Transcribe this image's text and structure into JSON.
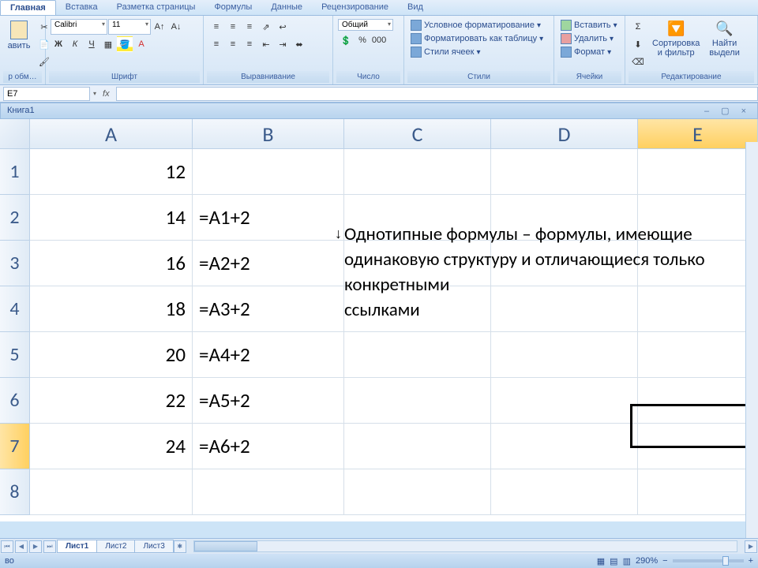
{
  "tabs": [
    "Главная",
    "Вставка",
    "Разметка страницы",
    "Формулы",
    "Данные",
    "Рецензирование",
    "Вид"
  ],
  "active_tab": 0,
  "ribbon": {
    "clipboard": {
      "paste": "авить",
      "label": "р обм…"
    },
    "font": {
      "name": "Calibri",
      "size": "11",
      "bold": "Ж",
      "italic": "К",
      "underline": "Ч",
      "label": "Шрифт"
    },
    "align": {
      "label": "Выравнивание"
    },
    "number": {
      "format": "Общий",
      "label": "Число"
    },
    "styles": {
      "cond": "Условное форматирование",
      "table": "Форматировать как таблицу",
      "cell": "Стили ячеек",
      "label": "Стили"
    },
    "cells": {
      "insert": "Вставить",
      "delete": "Удалить",
      "format": "Формат",
      "label": "Ячейки"
    },
    "editing": {
      "sort": "Сортировка\nи фильтр",
      "find": "Найти\nвыдели",
      "label": "Редактирование"
    }
  },
  "namebox": "E7",
  "doc_title": "Книга1",
  "columns": [
    "A",
    "B",
    "C",
    "D",
    "E"
  ],
  "col_widths": {
    "A": 206,
    "B": 192,
    "C": 186,
    "D": 186,
    "E": 152
  },
  "rows": [
    {
      "n": "1",
      "a": "12",
      "b": ""
    },
    {
      "n": "2",
      "a": "14",
      "b": "=A1+2"
    },
    {
      "n": "3",
      "a": "16",
      "b": "=A2+2"
    },
    {
      "n": "4",
      "a": "18",
      "b": "=A3+2"
    },
    {
      "n": "5",
      "a": "20",
      "b": "=A4+2"
    },
    {
      "n": "6",
      "a": "22",
      "b": "=A5+2"
    },
    {
      "n": "7",
      "a": "24",
      "b": "=A6+2"
    },
    {
      "n": "8",
      "a": "",
      "b": ""
    }
  ],
  "selected": {
    "row": 7,
    "col": "E",
    "cell": "E7"
  },
  "overlay": "Однотипные формулы – формулы, имеющие одинаковую структуру и отличающиеся только конкретными\n ссылками",
  "sheets": [
    "Лист1",
    "Лист2",
    "Лист3"
  ],
  "active_sheet": 0,
  "status_left": "во",
  "zoom": "290%"
}
